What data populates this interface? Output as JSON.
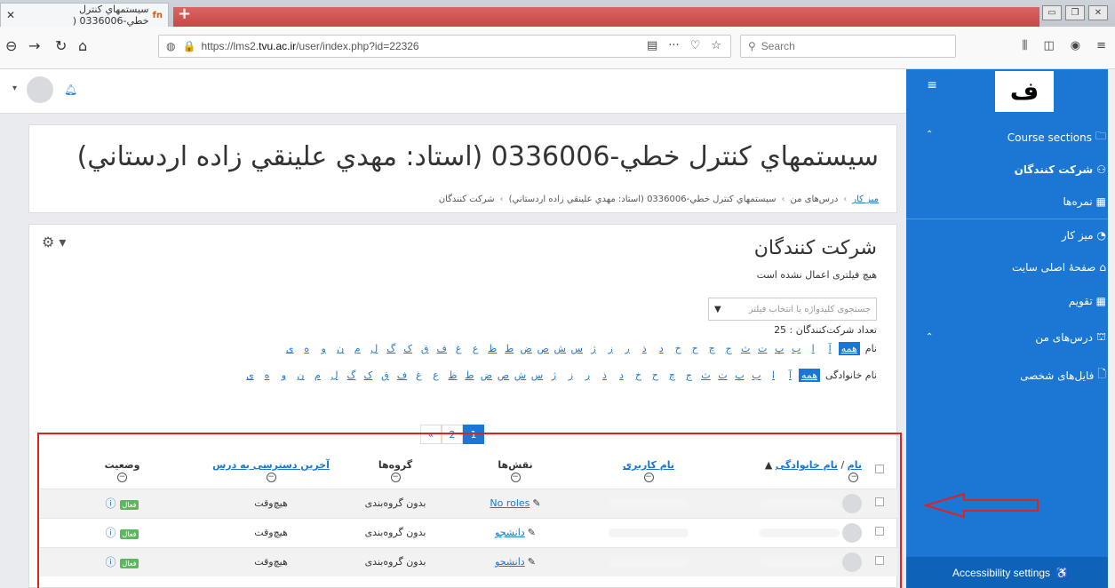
{
  "browser": {
    "tab_title": "سیستمهاي کنترل خطي-0336006 (",
    "tab_favicon": "fn",
    "url_prefix": "https://lms2.",
    "url_domain": "tvu.ac.ir",
    "url_path": "/user/index.php?id=22326",
    "search_placeholder": "Search"
  },
  "sidebar": {
    "logo_text": "ف",
    "items": [
      {
        "label": "Course sections",
        "icon": "folder-icon"
      },
      {
        "label": "شرکت کنندگان",
        "icon": "users-icon"
      },
      {
        "label": "نمره‌ها",
        "icon": "grades-icon"
      },
      {
        "label": "میز کار",
        "icon": "dashboard-icon"
      },
      {
        "label": "صفحهٔ اصلی سایت",
        "icon": "home-icon"
      },
      {
        "label": "تقویم",
        "icon": "calendar-icon"
      },
      {
        "label": "درس‌های من",
        "icon": "graduation-icon"
      },
      {
        "label": "فایل‌های شخصی",
        "icon": "file-icon"
      }
    ],
    "accessibility": "Accessibility settings"
  },
  "course": {
    "title": "سیستمهاي کنترل خطي-0336006 (استاد: مهدي علينقي زاده اردستاني)",
    "breadcrumbs": [
      "میز کار",
      "درس‌های من",
      "سیستمهاي کنترل خطي-0336006 (استاد: مهدي علينقي زاده اردستاني)",
      "شرکت کنندگان"
    ]
  },
  "participants": {
    "title": "شرکت کنندگان",
    "no_filter": "هیچ فیلتری اعمال نشده است",
    "filter_placeholder": "جستجوی کلیدواژه یا انتخاب فیلتر",
    "count": "تعداد شرکت‌کنندگان : 25",
    "first_label": "نام",
    "last_label": "نام خانوادگی",
    "all": "همه",
    "letters": [
      "آ",
      "ا",
      "ب",
      "پ",
      "ت",
      "ث",
      "ج",
      "چ",
      "ح",
      "خ",
      "د",
      "ذ",
      "ر",
      "ز",
      "ژ",
      "س",
      "ش",
      "ص",
      "ض",
      "ط",
      "ظ",
      "ع",
      "غ",
      "ف",
      "ق",
      "ک",
      "گ",
      "ل",
      "م",
      "ن",
      "و",
      "ه",
      "ی"
    ],
    "pages": [
      "1",
      "2",
      "»"
    ]
  },
  "table": {
    "headers": {
      "name": "نام",
      "name_sep": " / ",
      "lastname": "نام خانوادگی",
      "username": "نام کاربری",
      "roles": "نقش‌ها",
      "groups": "گروه‌ها",
      "last_access": "آخرین دسترسی به درس",
      "status": "وضعیت"
    },
    "rows": [
      {
        "role": "No roles",
        "group": "بدون گروه‌بندی",
        "access": "هیچ‌وقت",
        "status": "فعال"
      },
      {
        "role": "دانشجو",
        "group": "بدون گروه‌بندی",
        "access": "هیچ‌وقت",
        "status": "فعال"
      },
      {
        "role": "دانشجو",
        "group": "بدون گروه‌بندی",
        "access": "هیچ‌وقت",
        "status": "فعال"
      }
    ]
  }
}
